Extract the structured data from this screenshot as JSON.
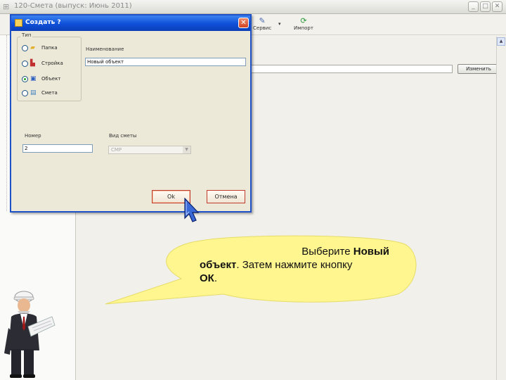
{
  "app": {
    "title": "120-Смета  (выпуск: Июнь 2011)",
    "window_buttons": [
      "_",
      "□",
      "✕"
    ],
    "toolbar": [
      {
        "label": "Сервис",
        "icon": "service-icon"
      },
      {
        "label": "Импорт",
        "icon": "import-icon"
      }
    ],
    "change_button": "Изменить"
  },
  "dialog": {
    "title": "Создать ?",
    "close_glyph": "✕",
    "type_group": {
      "legend": "Тип",
      "options": [
        {
          "label": "Папка",
          "icon": "folder-icon",
          "selected": false
        },
        {
          "label": "Стройка",
          "icon": "construction-icon",
          "selected": false
        },
        {
          "label": "Объект",
          "icon": "object-icon",
          "selected": true
        },
        {
          "label": "Смета",
          "icon": "estimate-icon",
          "selected": false
        }
      ]
    },
    "name_label": "Наименование",
    "name_value": "Новый объект",
    "number_label": "Номер",
    "number_value": "2",
    "view_label": "Вид сметы",
    "view_value": "СМР",
    "ok_label": "Ok",
    "cancel_label": "Отмена"
  },
  "callout": {
    "line1_pre": "Выберите ",
    "line1_bold": "Новый",
    "line2_bold": "объект",
    "line2_rest": ". Затем нажмите кнопку",
    "line3_bold": "ОК",
    "line3_rest": "."
  },
  "colors": {
    "dialog_title": "#0e4fd8",
    "button_border": "#c0392b",
    "callout_fill": "#fff68f"
  }
}
